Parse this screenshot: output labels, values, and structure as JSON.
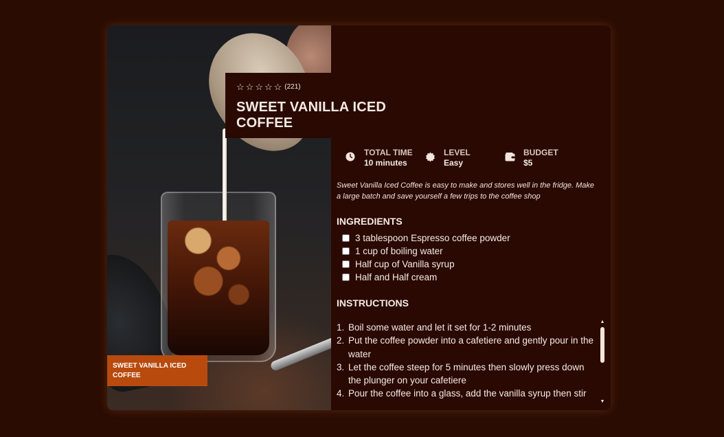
{
  "recipe": {
    "title": "SWEET VANILLA ICED COFFEE",
    "photo_label": "SWEET VANILLA ICED COFFEE",
    "rating": {
      "stars": [
        "☆",
        "☆",
        "☆",
        "☆",
        "☆"
      ],
      "count": "(221)"
    },
    "meta": {
      "time": {
        "icon": "clock-icon",
        "label": "TOTAL TIME",
        "value": "10 minutes"
      },
      "level": {
        "icon": "badge-icon",
        "label": "LEVEL",
        "value": "Easy"
      },
      "budget": {
        "icon": "wallet-icon",
        "label": "BUDGET",
        "value": "$5"
      }
    },
    "description": "Sweet Vanilla Iced Coffee is easy to make and stores well in the fridge. Make a large batch and save yourself a few trips to the coffee shop",
    "ingredients_title": "INGREDIENTS",
    "ingredients": [
      {
        "label": "3 tablespoon Espresso coffee powder",
        "checked": false
      },
      {
        "label": "1 cup of boiling water",
        "checked": false
      },
      {
        "label": "Half cup of Vanilla syrup",
        "checked": false
      },
      {
        "label": "Half and Half cream",
        "checked": false
      }
    ],
    "instructions_title": "INSTRUCTIONS",
    "instructions": [
      {
        "num": "1.",
        "text": "Boil some water and let it set for 1-2 minutes"
      },
      {
        "num": "2.",
        "text": "Put the coffee powder into a cafetiere and gently pour in the water"
      },
      {
        "num": "3.",
        "text": "Let the coffee steep for 5 minutes then slowly press down the plunger on your cafetiere"
      },
      {
        "num": "4.",
        "text": "Pour the coffee into a glass, add the vanilla syrup then stir"
      }
    ]
  },
  "colors": {
    "page_background": "#2b0c02",
    "card_background": "#2a0903",
    "accent": "#b84a0e",
    "text": "#f4ebe3"
  }
}
